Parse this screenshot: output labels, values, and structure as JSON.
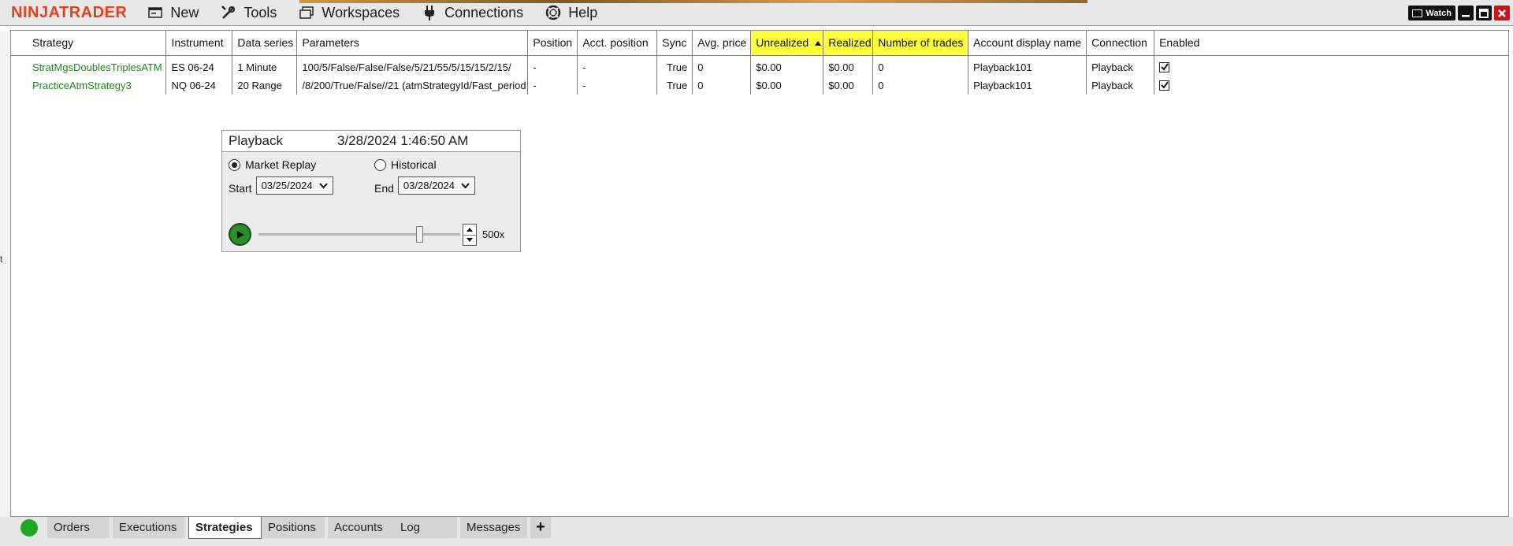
{
  "app": {
    "logo": "NINJATRADER",
    "menu": [
      {
        "label": "New",
        "icon": "new-window-icon"
      },
      {
        "label": "Tools",
        "icon": "tools-icon"
      },
      {
        "label": "Workspaces",
        "icon": "workspaces-icon"
      },
      {
        "label": "Connections",
        "icon": "plug-icon"
      },
      {
        "label": "Help",
        "icon": "help-lifebuoy-icon"
      }
    ],
    "watch_label": "Watch"
  },
  "colors": {
    "logo": "#e8401a",
    "highlight": "#ffff3c",
    "strategy_name": "#1a8a1a",
    "status_ok": "#1fa824",
    "close_button": "#c9151e"
  },
  "grid": {
    "columns": [
      "Strategy",
      "Instrument",
      "Data series",
      "Parameters",
      "Position",
      "Acct. position",
      "Sync",
      "Avg. price",
      "Unrealized",
      "Realized",
      "Number of trades",
      "Account display name",
      "Connection",
      "Enabled"
    ],
    "rows": [
      {
        "strategy": "StratMgsDoublesTriplesATM",
        "instrument": "ES 06-24",
        "data_series": "1 Minute",
        "parameters": "100/5/False/False/False/5/21/55/5/15/15/2/15/",
        "position": "-",
        "acct_position": "-",
        "sync": "True",
        "avg_price": "0",
        "unrealized": "$0.00",
        "realized": "$0.00",
        "num_trades": "0",
        "account": "Playback101",
        "connection": "Playback",
        "enabled": true
      },
      {
        "strategy": "PracticeAtmStrategy3",
        "instrument": "NQ 06-24",
        "data_series": "20 Range",
        "parameters": "/8/200/True/False//21 (atmStrategyId/Fast_period",
        "position": "-",
        "acct_position": "-",
        "sync": "True",
        "avg_price": "0",
        "unrealized": "$0.00",
        "realized": "$0.00",
        "num_trades": "0",
        "account": "Playback101",
        "connection": "Playback",
        "enabled": true
      }
    ]
  },
  "playback": {
    "title": "Playback",
    "time": "3/28/2024 1:46:50 AM",
    "mode_market_replay": "Market Replay",
    "mode_historical": "Historical",
    "selected_mode": "Market Replay",
    "start_label": "Start",
    "start_date": "03/25/2024",
    "end_label": "End",
    "end_date": "03/28/2024",
    "speed": "500x",
    "slider_position": 0.8
  },
  "tabs": [
    {
      "label": "Orders",
      "active": false
    },
    {
      "label": "Executions",
      "active": false
    },
    {
      "label": "Strategies",
      "active": true
    },
    {
      "label": "Positions",
      "active": false
    },
    {
      "label": "Accounts",
      "active": false
    },
    {
      "label": "Log",
      "active": false
    },
    {
      "label": "Messages",
      "active": false
    }
  ],
  "tab_add_label": "+"
}
